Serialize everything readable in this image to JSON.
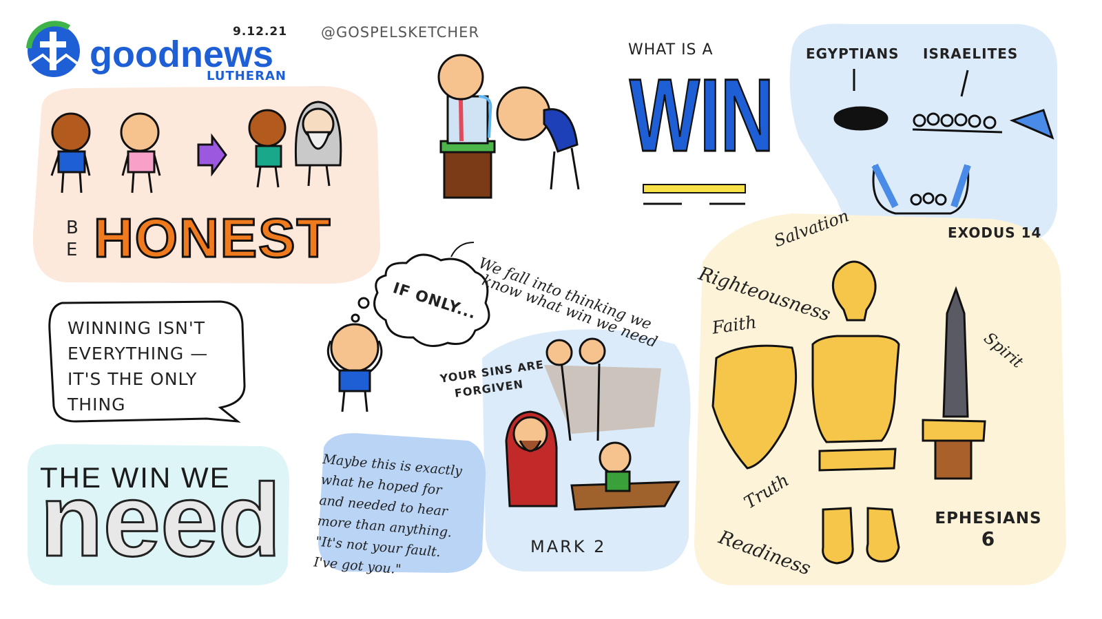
{
  "header": {
    "logo_word_1": "good",
    "logo_word_2": "news",
    "logo_sub": "LUTHERAN",
    "date": "9.12.21",
    "handle": "@GOSPELSKETCHER"
  },
  "be_honest": {
    "be": "BE",
    "honest": "HONEST"
  },
  "quote_bubble": {
    "lines": [
      "WINNING ISN'T",
      "EVERYTHING —",
      "IT'S THE ONLY",
      "THING"
    ]
  },
  "win_we_need": {
    "line1": "THE WIN WE",
    "line2": "need"
  },
  "what_is_a_win": {
    "prefix": "WHAT IS A",
    "word": "WIN"
  },
  "exodus": {
    "egyptians": "EGYPTIANS",
    "israelites": "ISRAELITES",
    "ref": "EXODUS 14"
  },
  "if_only": {
    "thought": "IF ONLY...",
    "note_line1": "We fall into thinking we",
    "note_line2": "know what win we need"
  },
  "mark": {
    "speech_line1": "YOUR SINS ARE",
    "speech_line2": "FORGIVEN",
    "ref": "MARK 2"
  },
  "maybe_note": {
    "lines": [
      "Maybe this is exactly",
      "what he hoped for",
      "and needed to hear",
      "more than anything.",
      "\"It's not your fault.",
      "I've got you.\""
    ]
  },
  "armor": {
    "salvation": "Salvation",
    "righteousness": "Righteousness",
    "faith": "Faith",
    "spirit": "Spirit",
    "truth": "Truth",
    "readiness": "Readiness",
    "ref_line1": "EPHESIANS",
    "ref_line2": "6"
  },
  "colors": {
    "orange": "#f07a1e",
    "blue": "#1f5fd6",
    "peach_bg": "#fde8dc",
    "light_blue_bg": "#dcebfa",
    "cream_bg": "#fdf3d9",
    "aqua_bg": "#ddf5f7",
    "gold": "#f5c64a"
  }
}
